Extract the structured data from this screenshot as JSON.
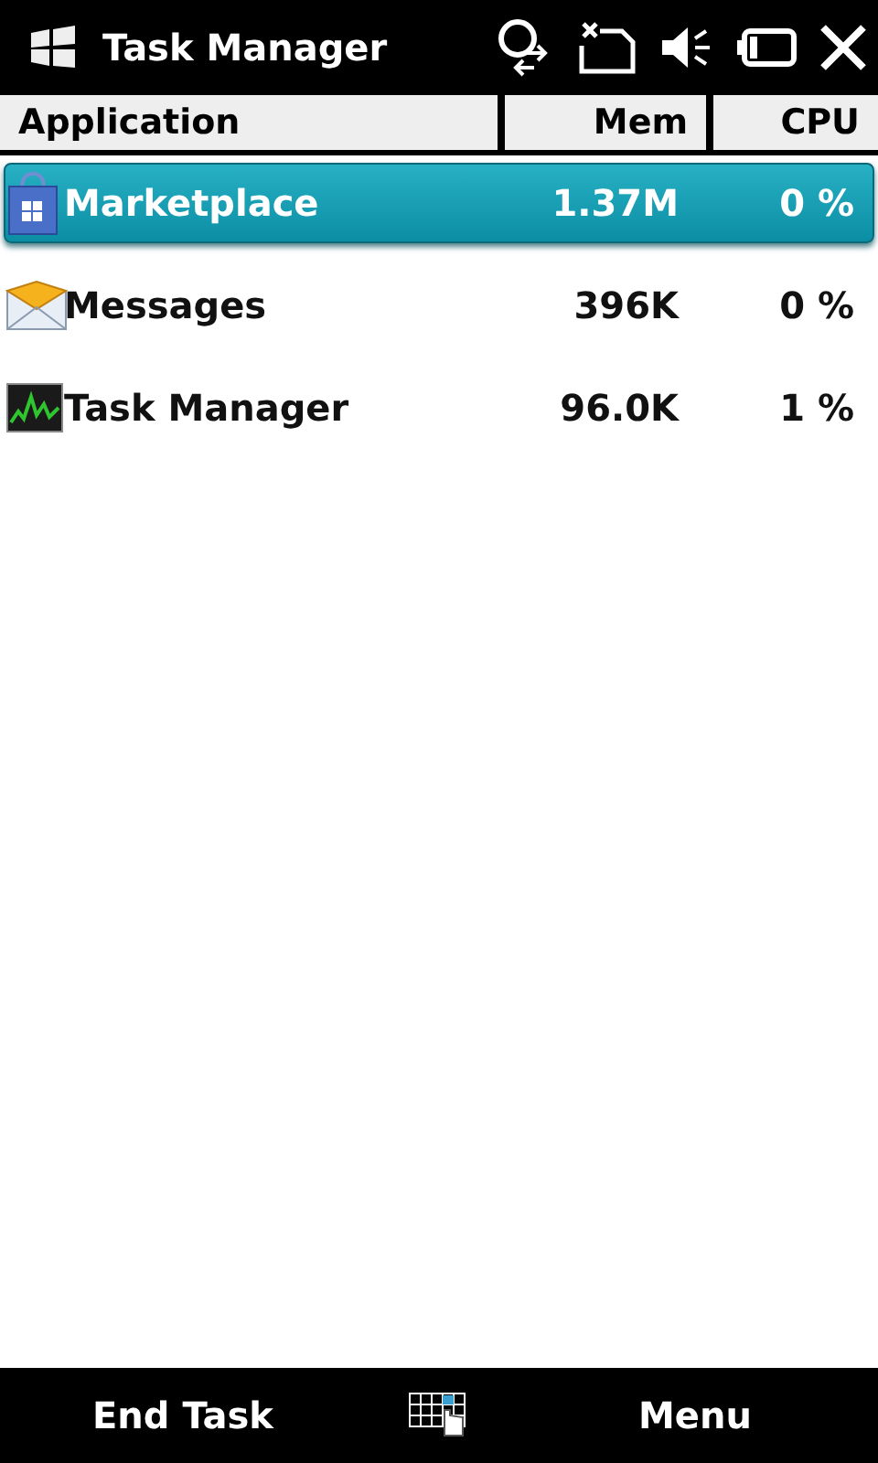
{
  "window": {
    "title": "Task Manager"
  },
  "table": {
    "columns": [
      "Application",
      "Mem",
      "CPU"
    ],
    "rows": [
      {
        "kind": "bag",
        "name": "Marketplace",
        "mem": "1.37M",
        "cpu": "0 %",
        "selected": true
      },
      {
        "kind": "envelope",
        "name": "Messages",
        "mem": "396K",
        "cpu": "0 %",
        "selected": false
      },
      {
        "kind": "monitor",
        "name": "Task Manager",
        "mem": "96.0K",
        "cpu": "1 %",
        "selected": false
      }
    ]
  },
  "softkeys": {
    "left": "End Task",
    "right": "Menu"
  }
}
